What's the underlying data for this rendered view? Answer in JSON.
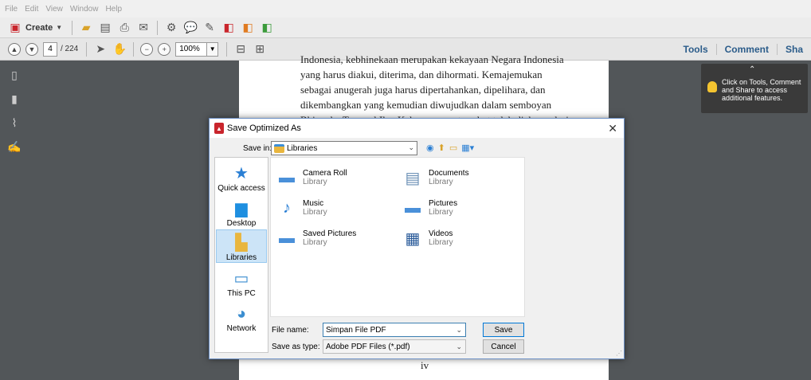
{
  "menu": [
    "File",
    "Edit",
    "View",
    "Window",
    "Help"
  ],
  "toolbar": {
    "create_label": "Create"
  },
  "nav": {
    "current_page": "4",
    "page_total": "/ 224",
    "zoom": "100%"
  },
  "panels": {
    "tools": "Tools",
    "comment": "Comment",
    "share": "Sha"
  },
  "document": {
    "lines": [
      "Indonesia, kebhinekaan merupakan kekayaan Negara Indonesia",
      "yang harus diakui, diterima, dan dihormati. Kemajemukan",
      "sebagai anugerah juga harus dipertahankan, dipelihara, dan",
      "dikembangkan yang kemudian diwujudkan dalam semboyan",
      "Bhinneka Tunggal Ika. Keberagaman tersebut telah diakomodasi"
    ],
    "page_number": "iv"
  },
  "hint": {
    "text": "Click on Tools, Comment and Share to access additional features."
  },
  "dialog": {
    "title": "Save Optimized As",
    "save_in_label": "Save in:",
    "save_in_value": "Libraries",
    "places": [
      "Quick access",
      "Desktop",
      "Libraries",
      "This PC",
      "Network"
    ],
    "items": [
      {
        "name": "Camera Roll",
        "type": "Library"
      },
      {
        "name": "Documents",
        "type": "Library"
      },
      {
        "name": "Music",
        "type": "Library"
      },
      {
        "name": "Pictures",
        "type": "Library"
      },
      {
        "name": "Saved Pictures",
        "type": "Library"
      },
      {
        "name": "Videos",
        "type": "Library"
      }
    ],
    "file_name_label": "File name:",
    "file_name_value": "Simpan File PDF",
    "save_as_type_label": "Save as type:",
    "save_as_type_value": "Adobe PDF Files (*.pdf)",
    "save_button": "Save",
    "cancel_button": "Cancel"
  }
}
